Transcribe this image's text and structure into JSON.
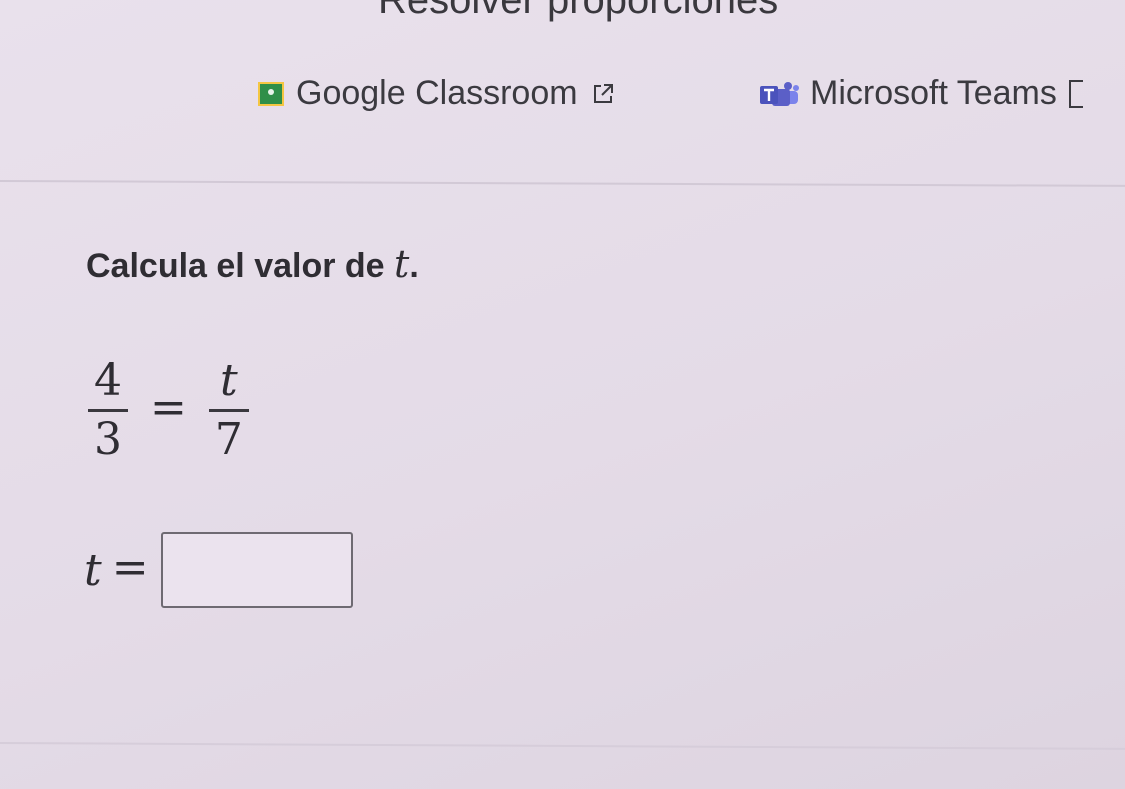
{
  "page": {
    "heading": "Resolver proporciones"
  },
  "share": {
    "classroom_label": "Google Classroom",
    "teams_label": "Microsoft Teams",
    "classroom_icon": "google-classroom-icon",
    "teams_icon": "microsoft-teams-icon",
    "external_icon": "external-link-icon"
  },
  "problem": {
    "prompt_text": "Calcula el valor de ",
    "prompt_var": "t",
    "prompt_end": ".",
    "lhs_numerator": "4",
    "lhs_denominator": "3",
    "equals": "=",
    "rhs_numerator": "t",
    "rhs_denominator": "7"
  },
  "answer": {
    "var": "t",
    "equals": "=",
    "value": "",
    "placeholder": ""
  },
  "colors": {
    "background": "#e6dde8",
    "text": "#2f2d33",
    "classroom_green": "#2f8f49",
    "teams_purple": "#5b5fc7"
  }
}
